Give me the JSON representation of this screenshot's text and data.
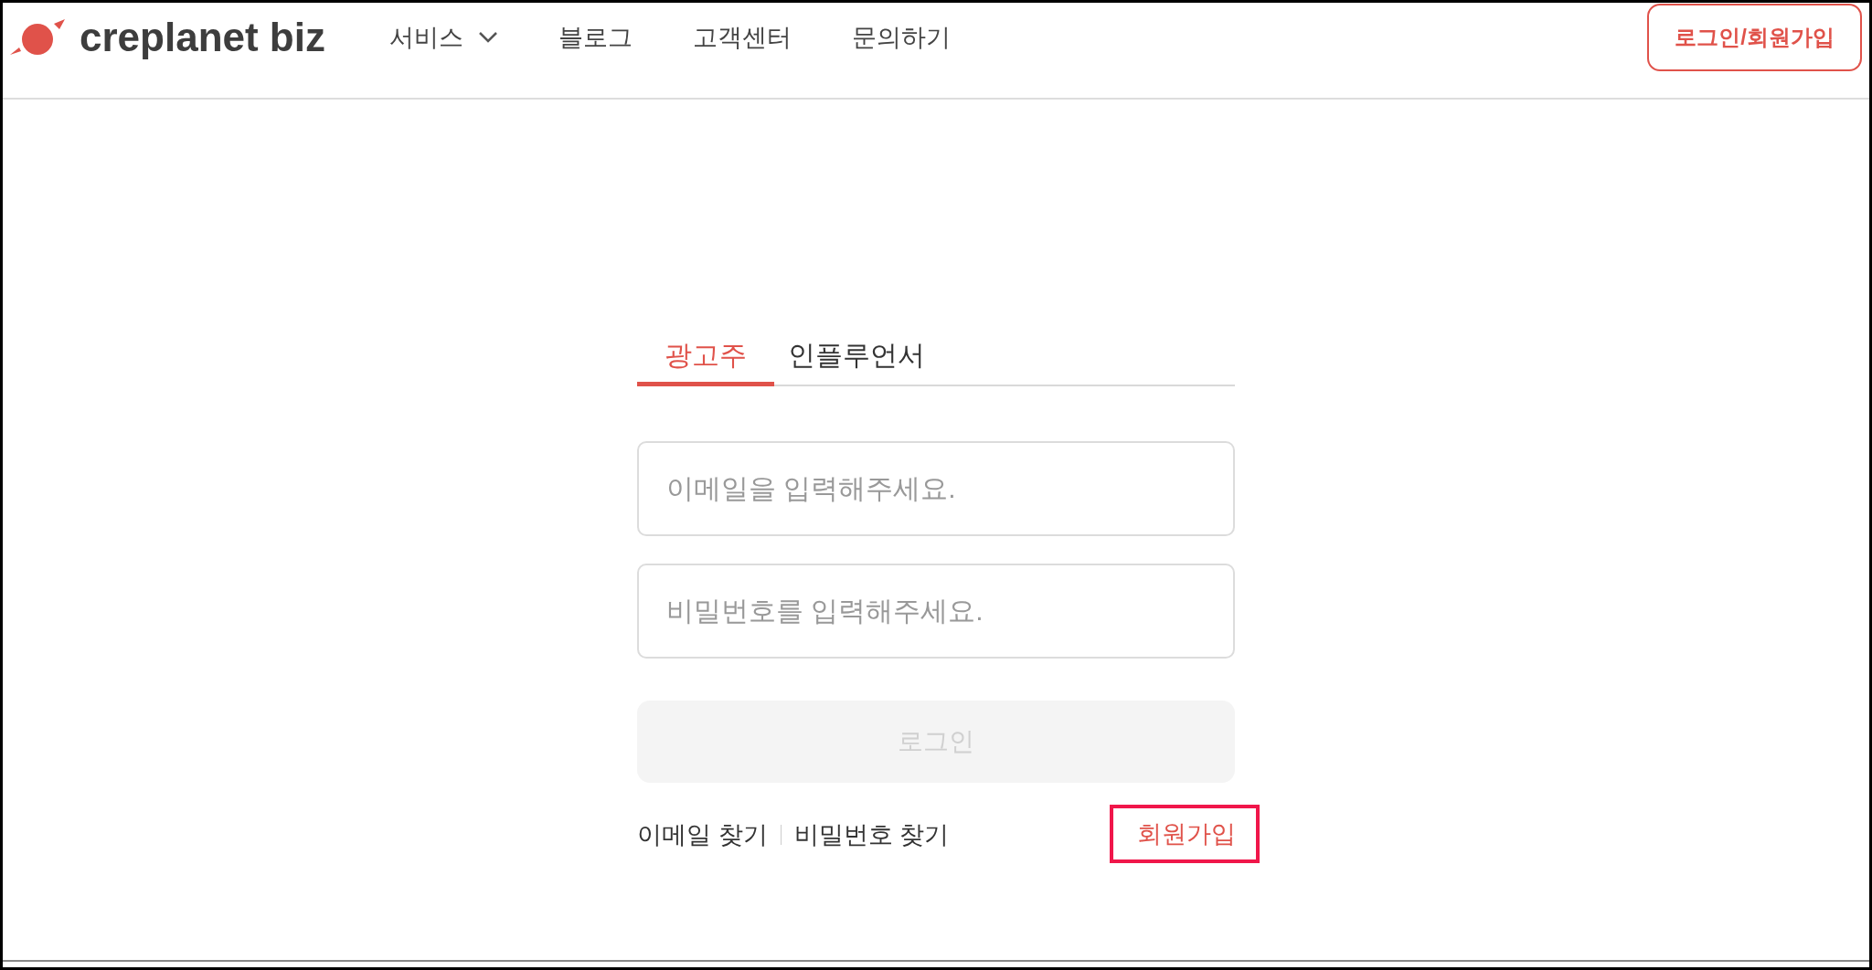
{
  "header": {
    "logo_text": "creplanet biz",
    "nav": [
      {
        "label": "서비스",
        "dropdown": true
      },
      {
        "label": "블로그",
        "dropdown": false
      },
      {
        "label": "고객센터",
        "dropdown": false
      },
      {
        "label": "문의하기",
        "dropdown": false
      }
    ],
    "login_signup_button": "로그인/회원가입"
  },
  "tabs": [
    {
      "label": "광고주",
      "selected": true
    },
    {
      "label": "인플루언서",
      "selected": false
    }
  ],
  "email_field": {
    "placeholder": "이메일을 입력해주세요."
  },
  "password_field": {
    "placeholder": "비밀번호를 입력해주세요."
  },
  "login_button": {
    "label": "로그인",
    "disabled": true
  },
  "links": {
    "find_email": "이메일 찾기",
    "find_password": "비밀번호 찾기",
    "signup": "회원가입",
    "signup_highlighted": true
  }
}
